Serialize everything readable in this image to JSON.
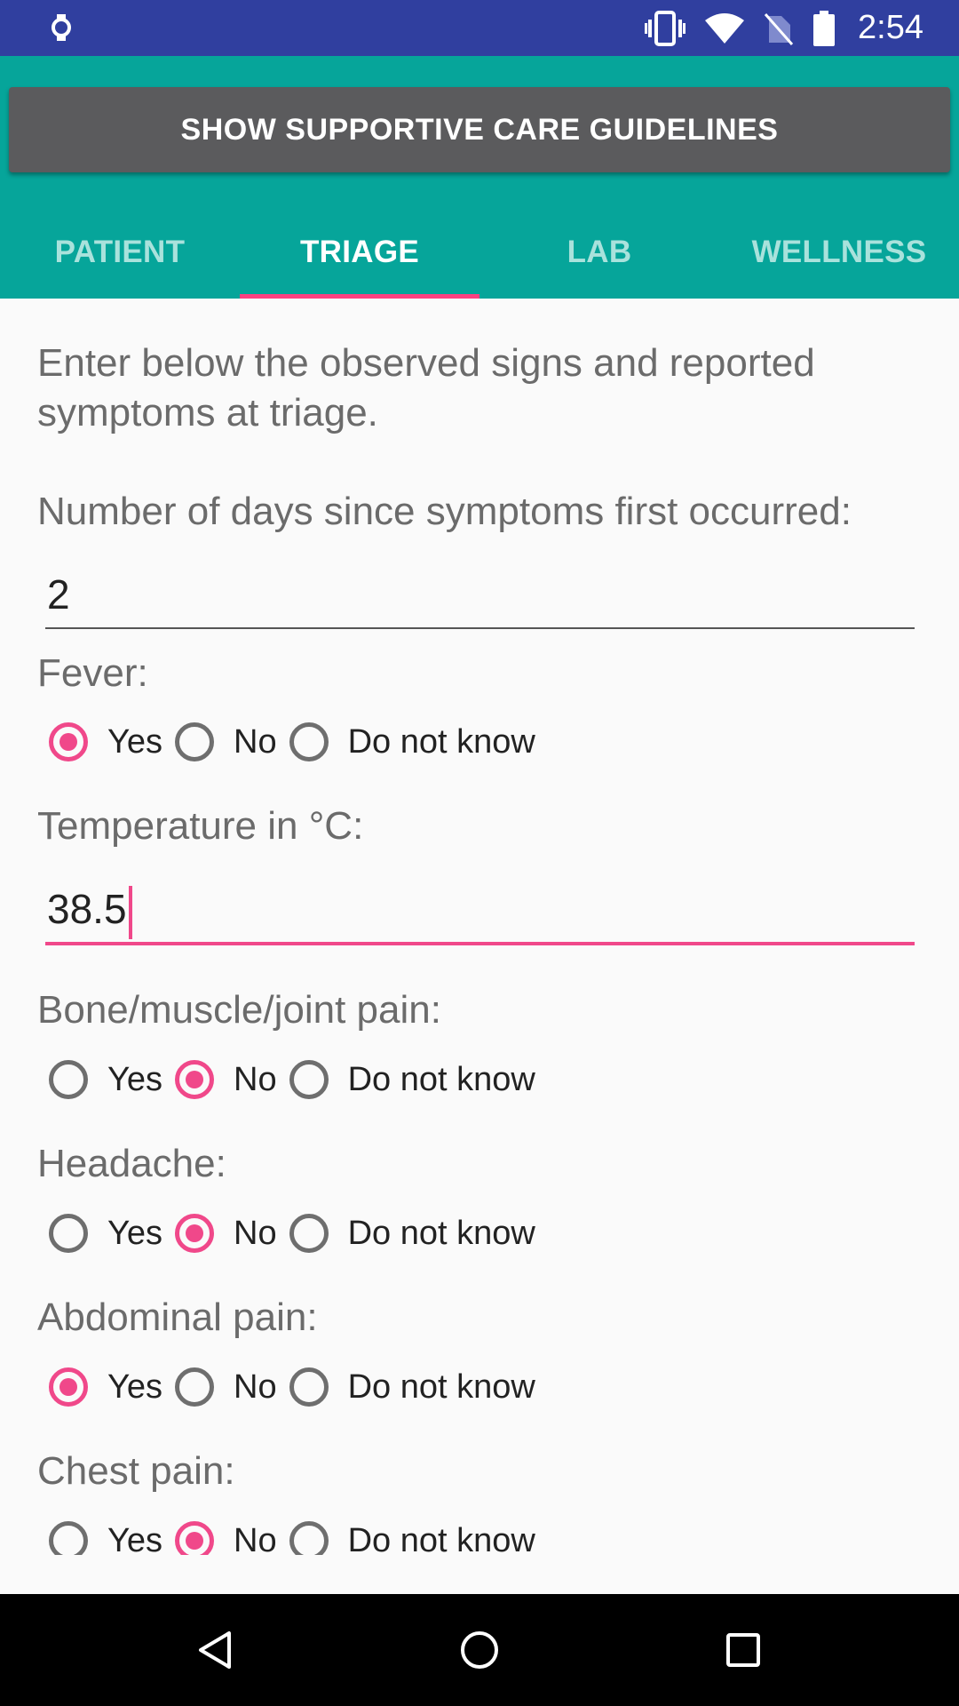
{
  "status_bar": {
    "time": "2:54",
    "icons": [
      "watch-icon",
      "vibrate-icon",
      "wifi-icon",
      "no-sim-icon",
      "battery-icon"
    ],
    "background": "#303f9f"
  },
  "header": {
    "guidelines_button_label": "SHOW SUPPORTIVE CARE GUIDELINES",
    "background": "#06a59a",
    "tabs": [
      {
        "label": "PATIENT",
        "active": false
      },
      {
        "label": "TRIAGE",
        "active": true
      },
      {
        "label": "LAB",
        "active": false
      },
      {
        "label": "WELLNESS",
        "active": false
      }
    ],
    "accent": "#ff4081"
  },
  "form": {
    "intro": "Enter below the observed signs and reported symptoms at triage.",
    "days_label": "Number of days since symptoms first occurred:",
    "days_value": "2",
    "temperature_label": "Temperature in °C:",
    "temperature_value": "38.5",
    "option_labels": [
      "Yes",
      "No",
      "Do not know"
    ],
    "questions": [
      {
        "label": "Fever:",
        "selected": "Yes"
      },
      {
        "label": "Bone/muscle/joint pain:",
        "selected": "No"
      },
      {
        "label": "Headache:",
        "selected": "No"
      },
      {
        "label": "Abdominal pain:",
        "selected": "Yes"
      },
      {
        "label": "Chest pain:",
        "selected": "No"
      }
    ]
  },
  "nav_bar": {
    "buttons": [
      "back-icon",
      "home-icon",
      "recents-icon"
    ]
  }
}
